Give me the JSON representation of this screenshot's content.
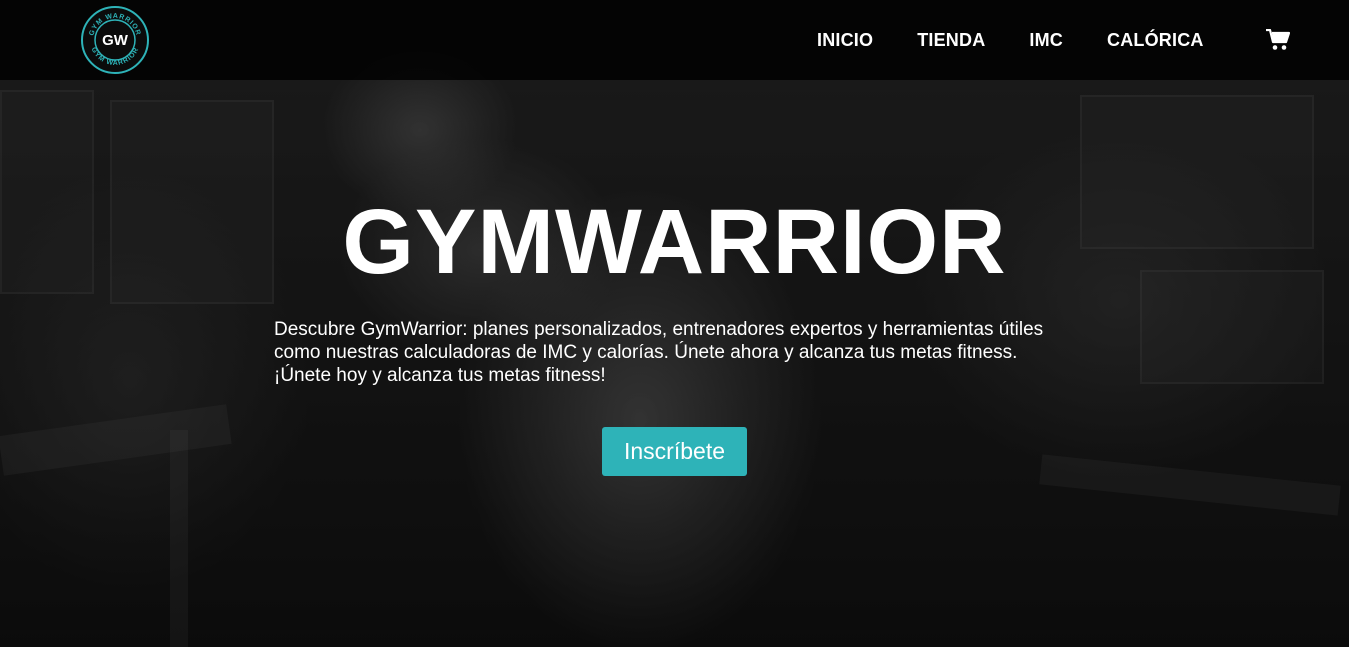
{
  "brand": {
    "logo_text_top": "GYM WARRIOR",
    "logo_text_bottom": "GYM WARRIOR",
    "logo_monogram": "GW",
    "accent_color": "#2eb3b8"
  },
  "nav": {
    "items": [
      {
        "label": "INICIO"
      },
      {
        "label": "TIENDA"
      },
      {
        "label": "IMC"
      },
      {
        "label": "CALÓRICA"
      }
    ],
    "cart_icon": "shopping-cart-icon"
  },
  "hero": {
    "title": "GYMWARRIOR",
    "description": "Descubre GymWarrior: planes personalizados, entrenadores expertos y herramientas útiles como nuestras calculadoras de IMC y calorías. Únete ahora y alcanza tus metas fitness. ¡Únete hoy y alcanza tus metas fitness!",
    "cta_label": "Inscríbete"
  }
}
